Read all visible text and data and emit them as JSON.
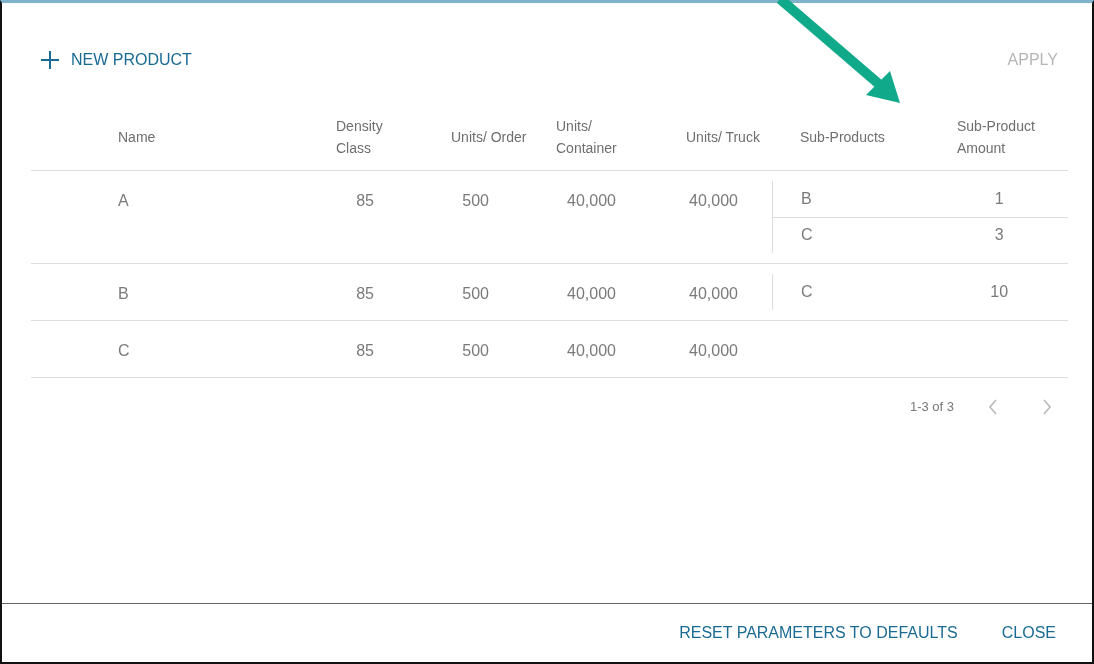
{
  "toolbar": {
    "new_product": {
      "label": "NEW PRODUCT"
    },
    "apply": {
      "label": "APPLY",
      "disabled": true
    }
  },
  "table": {
    "columns": [
      {
        "label": "Name"
      },
      {
        "label": "Density Class"
      },
      {
        "label": "Units/ Order"
      },
      {
        "label": "Units/ Container"
      },
      {
        "label": "Units/ Truck"
      },
      {
        "label": "Sub-Products"
      },
      {
        "label": "Sub-Product Amount"
      }
    ],
    "rows": [
      {
        "name": "A",
        "density_class": "85",
        "units_order": "500",
        "units_container": "40,000",
        "units_truck": "40,000",
        "sub_products": [
          {
            "name": "B",
            "amount": "1"
          },
          {
            "name": "C",
            "amount": "3"
          }
        ]
      },
      {
        "name": "B",
        "density_class": "85",
        "units_order": "500",
        "units_container": "40,000",
        "units_truck": "40,000",
        "sub_products": [
          {
            "name": "C",
            "amount": "10"
          }
        ]
      },
      {
        "name": "C",
        "density_class": "85",
        "units_order": "500",
        "units_container": "40,000",
        "units_truck": "40,000",
        "sub_products": []
      }
    ]
  },
  "pagination": {
    "range": "1-3 of 3",
    "previous_disabled": true,
    "next_disabled": true
  },
  "footer": {
    "buttons": [
      {
        "label": "RESET PARAMETERS TO DEFAULTS"
      },
      {
        "label": "CLOSE"
      }
    ]
  }
}
